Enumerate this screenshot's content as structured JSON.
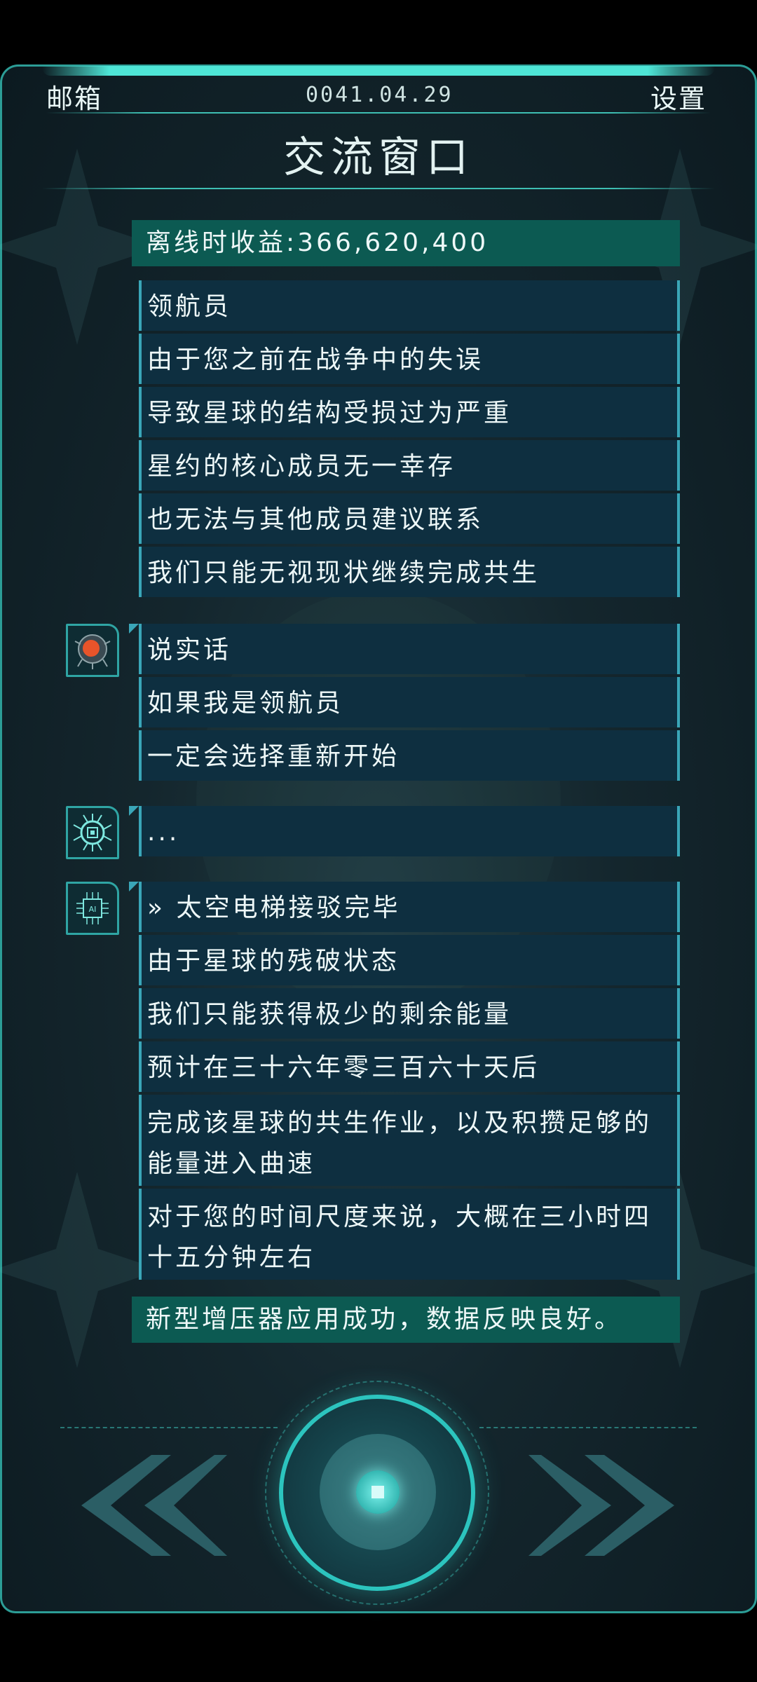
{
  "header": {
    "mailbox_label": "邮箱",
    "date": "0041.04.29",
    "settings_label": "设置",
    "title": "交流窗口"
  },
  "offline_banner": "离线时收益:366,620,400",
  "messages": {
    "group1": [
      "领航员",
      "由于您之前在战争中的失误",
      "导致星球的结构受损过为严重",
      "星约的核心成员无一幸存",
      "也无法与其他成员建议联系",
      "我们只能无视现状继续完成共生"
    ],
    "group2": [
      "说实话",
      "如果我是领航员",
      "一定会选择重新开始"
    ],
    "group3": [
      "..."
    ],
    "group4": [
      "» 太空电梯接驳完毕",
      "由于星球的残破状态",
      "我们只能获得极少的剩余能量",
      "预计在三十六年零三百六十天后",
      "完成该星球的共生作业，以及积攒足够的能量进入曲速",
      "对于您的时间尺度来说，大概在三小时四十五分钟左右"
    ]
  },
  "status_banner": "新型增压器应用成功，数据反映良好。",
  "avatars": [
    "brain-avatar-icon",
    "circuit-bug-avatar-icon",
    "ai-chip-avatar-icon"
  ],
  "colors": {
    "accent": "#2cc4be",
    "banner": "#0c5a52",
    "row_bg": "#0e2f40",
    "row_border": "#3aa6b8"
  }
}
